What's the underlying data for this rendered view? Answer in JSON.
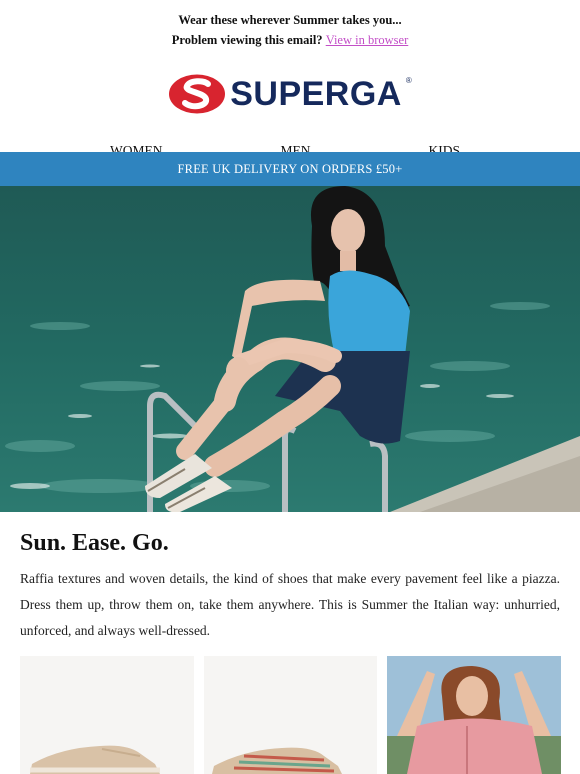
{
  "preheader": {
    "line1": "Wear these wherever Summer takes you...",
    "line2_prefix": "Problem viewing this email?",
    "view_link": "View in browser"
  },
  "brand": {
    "name": "SUPERGA",
    "registered": "®",
    "red": "#d8242f",
    "navy": "#15295c"
  },
  "nav": {
    "items": [
      "WOMEN",
      "MEN",
      "KIDS"
    ]
  },
  "banner": {
    "text": "FREE UK DELIVERY ON ORDERS £50+",
    "color": "#2f84bf"
  },
  "hero": {
    "icon": "woman-by-pool-photo"
  },
  "content": {
    "headline": "Sun. Ease. Go.",
    "body": "Raffia textures and woven details, the kind of shoes that make every pavement feel like a piazza. Dress them up, throw them on, take them anywhere. This is Summer the Italian way: unhurried, unforced, and always well-dressed."
  },
  "products": [
    {
      "icon": "raffia-sneaker-photo"
    },
    {
      "icon": "woven-striped-sneaker-photo"
    },
    {
      "icon": "woman-laughing-photo"
    }
  ]
}
